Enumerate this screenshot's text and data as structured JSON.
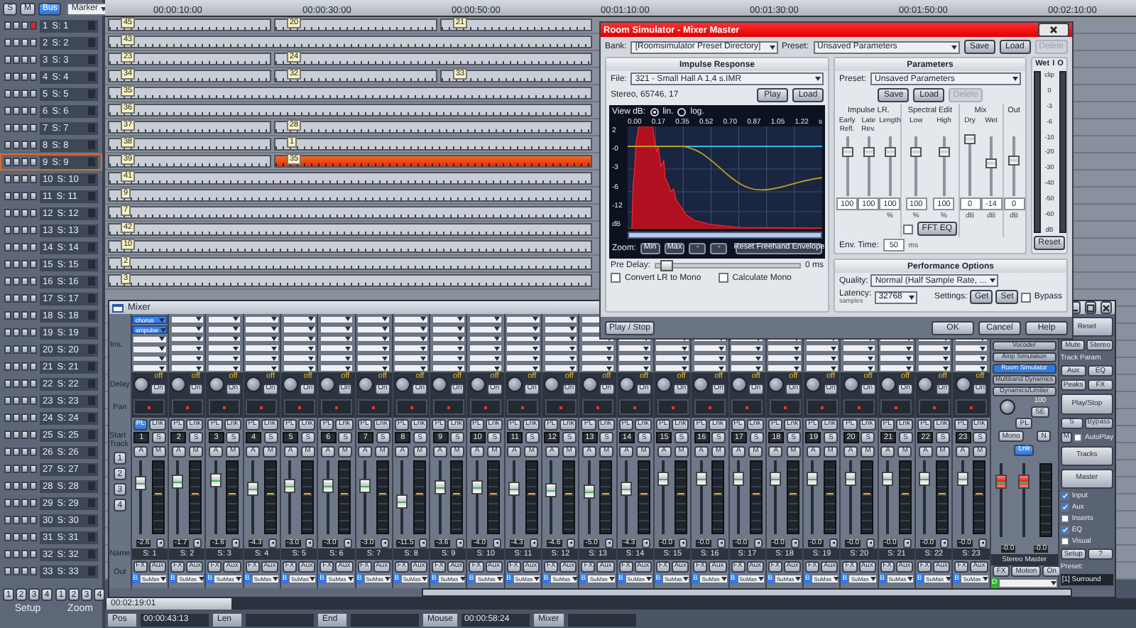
{
  "toolbar": {
    "buttons": [
      {
        "label": "S",
        "selected": false
      },
      {
        "label": "M",
        "selected": false
      },
      {
        "label": "Bus",
        "selected": true
      }
    ],
    "marker": "Marker"
  },
  "ruler": [
    "00:00:10:00",
    "00:00:30:00",
    "00:00:50:00",
    "00:01:10:00",
    "00:01:30:00",
    "00:01:50:00",
    "00:02:10:00"
  ],
  "tracks": [
    {
      "number": "1",
      "name": "S: 1",
      "armed": true,
      "selected": false,
      "clips": [
        {
          "label": "45",
          "selected": false
        },
        {
          "label": "20",
          "selected": false
        },
        {
          "label": "21",
          "selected": false
        }
      ]
    },
    {
      "number": "2",
      "name": "S: 2",
      "armed": false,
      "selected": false,
      "clips": [
        {
          "label": "43",
          "selected": false
        }
      ]
    },
    {
      "number": "3",
      "name": "S: 3",
      "armed": false,
      "selected": false,
      "clips": [
        {
          "label": "23",
          "selected": false
        },
        {
          "label": "24",
          "selected": false
        }
      ]
    },
    {
      "number": "4",
      "name": "S: 4",
      "armed": false,
      "selected": false,
      "clips": [
        {
          "label": "34",
          "selected": false
        },
        {
          "label": "32",
          "selected": false
        },
        {
          "label": "33",
          "selected": false
        }
      ]
    },
    {
      "number": "5",
      "name": "S: 5",
      "armed": false,
      "selected": false,
      "clips": [
        {
          "label": "35",
          "selected": false
        }
      ]
    },
    {
      "number": "6",
      "name": "S: 6",
      "armed": false,
      "selected": false,
      "clips": [
        {
          "label": "36",
          "selected": false
        }
      ]
    },
    {
      "number": "7",
      "name": "S: 7",
      "armed": false,
      "selected": false,
      "clips": [
        {
          "label": "37",
          "selected": false
        },
        {
          "label": "28",
          "selected": false
        }
      ]
    },
    {
      "number": "8",
      "name": "S: 8",
      "armed": false,
      "selected": false,
      "clips": [
        {
          "label": "38",
          "selected": false
        },
        {
          "label": "1",
          "selected": false
        }
      ]
    },
    {
      "number": "9",
      "name": "S: 9",
      "armed": false,
      "selected": true,
      "clips": [
        {
          "label": "39",
          "selected": false
        },
        {
          "label": "35",
          "selected": true
        }
      ]
    },
    {
      "number": "10",
      "name": "S: 10",
      "armed": false,
      "selected": false,
      "clips": [
        {
          "label": "41",
          "selected": false
        }
      ]
    },
    {
      "number": "11",
      "name": "S: 11",
      "armed": false,
      "selected": false,
      "clips": [
        {
          "label": "9",
          "selected": false
        }
      ]
    },
    {
      "number": "12",
      "name": "S: 12",
      "armed": false,
      "selected": false,
      "clips": [
        {
          "label": "7",
          "selected": false
        }
      ]
    },
    {
      "number": "13",
      "name": "S: 13",
      "armed": false,
      "selected": false,
      "clips": [
        {
          "label": "42",
          "selected": false
        }
      ]
    },
    {
      "number": "14",
      "name": "S: 14",
      "armed": false,
      "selected": false,
      "clips": [
        {
          "label": "10",
          "selected": false
        }
      ]
    },
    {
      "number": "15",
      "name": "S: 15",
      "armed": false,
      "selected": false,
      "clips": [
        {
          "label": "2",
          "selected": false
        }
      ]
    },
    {
      "number": "16",
      "name": "S: 16",
      "armed": false,
      "selected": false,
      "clips": [
        {
          "label": "3",
          "selected": false
        }
      ]
    },
    {
      "number": "17",
      "name": "S: 17",
      "armed": false,
      "selected": false
    },
    {
      "number": "18",
      "name": "S: 18",
      "armed": false,
      "selected": false
    },
    {
      "number": "19",
      "name": "S: 19",
      "armed": false,
      "selected": false
    },
    {
      "number": "20",
      "name": "S: 20",
      "armed": false,
      "selected": false
    },
    {
      "number": "21",
      "name": "S: 21",
      "armed": false,
      "selected": false
    },
    {
      "number": "22",
      "name": "S: 22",
      "armed": false,
      "selected": false
    },
    {
      "number": "23",
      "name": "S: 23",
      "armed": false,
      "selected": false
    },
    {
      "number": "24",
      "name": "S: 24",
      "armed": false,
      "selected": false
    },
    {
      "number": "25",
      "name": "S: 25",
      "armed": false,
      "selected": false
    },
    {
      "number": "26",
      "name": "S: 26",
      "armed": false,
      "selected": false
    },
    {
      "number": "27",
      "name": "S: 27",
      "armed": false,
      "selected": false
    },
    {
      "number": "28",
      "name": "S: 28",
      "armed": false,
      "selected": false
    },
    {
      "number": "29",
      "name": "S: 29",
      "armed": false,
      "selected": false
    },
    {
      "number": "30",
      "name": "S: 30",
      "armed": false,
      "selected": false
    },
    {
      "number": "31",
      "name": "S: 31",
      "armed": false,
      "selected": false
    },
    {
      "number": "32",
      "name": "S: 32",
      "armed": false,
      "selected": false
    },
    {
      "number": "33",
      "name": "S: 33",
      "armed": false,
      "selected": false
    }
  ],
  "footer": {
    "setup_buttons": [
      "1",
      "2",
      "3",
      "4"
    ],
    "setup_label": "Setup",
    "zoom_buttons": [
      "1",
      "2",
      "3",
      "4"
    ],
    "zoom_label": "Zoom"
  },
  "status_bar": {
    "scroll_time": "00:02:19:01",
    "fields": [
      {
        "label": "Pos",
        "value": "00:00:43:13"
      },
      {
        "label": "Len"
      },
      {
        "label": "End"
      },
      {
        "label": "Mouse",
        "value": "00:00:58:24"
      },
      {
        "label": "Mixer"
      }
    ]
  },
  "mixer": {
    "title": "Mixer",
    "row_labels": {
      "inserts": "Ins.",
      "delay": "Delay",
      "pan": "Pan",
      "start_track": "Start Track",
      "name": "Name",
      "out": "Out"
    },
    "start_buttons": [
      "1",
      "2",
      "3",
      "4"
    ],
    "channels": [
      {
        "number": "1",
        "name": "S: 1",
        "reading": "-2.6",
        "level": 0.7,
        "inserts": [
          "chorus",
          "ampulse"
        ],
        "delay": "off",
        "delay_button": "On",
        "pl": {
          "label": "PL",
          "selected": true
        },
        "link": "Lnk",
        "solo": "S",
        "auto": "A",
        "mute": "M",
        "fx": "FX",
        "aux": "Aux",
        "out_badge": "B",
        "out": "SuMas"
      },
      {
        "number": "2",
        "name": "S: 2",
        "reading": "-1.7",
        "level": 0.72,
        "delay": "off",
        "delay_button": "On",
        "pl": {
          "label": "PL",
          "selected": false
        },
        "link": "Lnk",
        "solo": "S",
        "auto": "A",
        "mute": "M",
        "fx": "FX",
        "aux": "Aux",
        "out_badge": "B",
        "out": "SuMas"
      },
      {
        "number": "3",
        "name": "S: 3",
        "reading": "-1.6",
        "level": 0.74,
        "delay": "off",
        "delay_button": "On",
        "pl": {
          "label": "PL",
          "selected": false
        },
        "link": "Lnk",
        "solo": "S",
        "auto": "A",
        "mute": "M",
        "fx": "FX",
        "aux": "Aux",
        "out_badge": "B",
        "out": "SuMas"
      },
      {
        "number": "4",
        "name": "S: 4",
        "reading": "-4.3",
        "level": 0.62,
        "delay": "off",
        "delay_button": "On",
        "pl": {
          "label": "PL",
          "selected": false
        },
        "link": "Lnk",
        "solo": "S",
        "auto": "A",
        "mute": "M",
        "fx": "FX",
        "aux": "Aux",
        "out_badge": "B",
        "out": "SuMas"
      },
      {
        "number": "5",
        "name": "S: 5",
        "reading": "-3.0",
        "level": 0.66,
        "delay": "off",
        "delay_button": "On",
        "pl": {
          "label": "PL",
          "selected": false
        },
        "link": "Lnk",
        "solo": "S",
        "auto": "A",
        "mute": "M",
        "fx": "FX",
        "aux": "Aux",
        "out_badge": "B",
        "out": "SuMas"
      },
      {
        "number": "6",
        "name": "S: 6",
        "reading": "-3.0",
        "level": 0.66,
        "delay": "off",
        "delay_button": "On",
        "pl": {
          "label": "PL",
          "selected": false
        },
        "link": "Lnk",
        "solo": "S",
        "auto": "A",
        "mute": "M",
        "fx": "FX",
        "aux": "Aux",
        "out_badge": "B",
        "out": "SuMas"
      },
      {
        "number": "7",
        "name": "S: 7",
        "reading": "-3.0",
        "level": 0.66,
        "delay": "off",
        "delay_button": "On",
        "pl": {
          "label": "PL",
          "selected": false
        },
        "link": "Lnk",
        "solo": "S",
        "auto": "A",
        "mute": "M",
        "fx": "FX",
        "aux": "Aux",
        "out_badge": "B",
        "out": "SuMas"
      },
      {
        "number": "8",
        "name": "S: 8",
        "reading": "-11.5",
        "level": 0.45,
        "delay": "off",
        "delay_button": "On",
        "pl": {
          "label": "PL",
          "selected": false
        },
        "link": "Lnk",
        "solo": "S",
        "auto": "A",
        "mute": "M",
        "fx": "FX",
        "aux": "Aux",
        "out_badge": "B",
        "out": "SuMas"
      },
      {
        "number": "9",
        "name": "S: 9",
        "reading": "-3.6",
        "level": 0.64,
        "delay": "off",
        "delay_button": "On",
        "pl": {
          "label": "PL",
          "selected": false
        },
        "link": "Lnk",
        "solo": "S",
        "auto": "A",
        "mute": "M",
        "fx": "FX",
        "aux": "Aux",
        "out_badge": "B",
        "out": "SuMas"
      },
      {
        "number": "10",
        "name": "S: 10",
        "reading": "-4.0",
        "level": 0.63,
        "delay": "off",
        "delay_button": "On",
        "pl": {
          "label": "PL",
          "selected": false
        },
        "link": "Lnk",
        "solo": "S",
        "auto": "A",
        "mute": "M",
        "fx": "FX",
        "aux": "Aux",
        "out_badge": "B",
        "out": "SuMas"
      },
      {
        "number": "11",
        "name": "S: 11",
        "reading": "-4.3",
        "level": 0.62,
        "delay": "off",
        "delay_button": "On",
        "pl": {
          "label": "PL",
          "selected": false
        },
        "link": "Lnk",
        "solo": "S",
        "auto": "A",
        "mute": "M",
        "fx": "FX",
        "aux": "Aux",
        "out_badge": "B",
        "out": "SuMas"
      },
      {
        "number": "12",
        "name": "S: 12",
        "reading": "-4.6",
        "level": 0.6,
        "delay": "off",
        "delay_button": "On",
        "pl": {
          "label": "PL",
          "selected": false
        },
        "link": "Lnk",
        "solo": "S",
        "auto": "A",
        "mute": "M",
        "fx": "FX",
        "aux": "Aux",
        "out_badge": "B",
        "out": "SuMas"
      },
      {
        "number": "13",
        "name": "S: 13",
        "reading": "-5.0",
        "level": 0.58,
        "delay": "off",
        "delay_button": "On",
        "pl": {
          "label": "PL",
          "selected": false
        },
        "link": "Lnk",
        "solo": "S",
        "auto": "A",
        "mute": "M",
        "fx": "FX",
        "aux": "Aux",
        "out_badge": "B",
        "out": "SuMas"
      },
      {
        "number": "14",
        "name": "S: 14",
        "reading": "-4.3",
        "level": 0.62,
        "delay": "off",
        "delay_button": "On",
        "pl": {
          "label": "PL",
          "selected": false
        },
        "link": "Lnk",
        "solo": "S",
        "auto": "A",
        "mute": "M",
        "fx": "FX",
        "aux": "Aux",
        "out_badge": "B",
        "out": "SuMas"
      },
      {
        "number": "15",
        "name": "S: 15",
        "reading": "-0.0",
        "level": 0.75,
        "delay": "off",
        "delay_button": "On",
        "pl": {
          "label": "PL",
          "selected": false
        },
        "link": "Lnk",
        "solo": "S",
        "auto": "A",
        "mute": "M",
        "fx": "FX",
        "aux": "Aux",
        "out_badge": "B",
        "out": "SuMas"
      },
      {
        "number": "16",
        "name": "S: 16",
        "reading": "-0.0",
        "level": 0.75,
        "delay": "off",
        "delay_button": "On",
        "pl": {
          "label": "PL",
          "selected": false
        },
        "link": "Lnk",
        "solo": "S",
        "auto": "A",
        "mute": "M",
        "fx": "FX",
        "aux": "Aux",
        "out_badge": "B",
        "out": "SuMas"
      },
      {
        "number": "17",
        "name": "S: 17",
        "reading": "-0.0",
        "level": 0.75,
        "delay": "off",
        "delay_button": "On",
        "pl": {
          "label": "PL",
          "selected": false
        },
        "link": "Lnk",
        "solo": "S",
        "auto": "A",
        "mute": "M",
        "fx": "FX",
        "aux": "Aux",
        "out_badge": "B",
        "out": "SuMas"
      },
      {
        "number": "18",
        "name": "S: 18",
        "reading": "-0.0",
        "level": 0.75,
        "delay": "off",
        "delay_button": "On",
        "pl": {
          "label": "PL",
          "selected": false
        },
        "link": "Lnk",
        "solo": "S",
        "auto": "A",
        "mute": "M",
        "fx": "FX",
        "aux": "Aux",
        "out_badge": "B",
        "out": "SuMas"
      },
      {
        "number": "19",
        "name": "S: 19",
        "reading": "-0.0",
        "level": 0.75,
        "delay": "off",
        "delay_button": "On",
        "pl": {
          "label": "PL",
          "selected": false
        },
        "link": "Lnk",
        "solo": "S",
        "auto": "A",
        "mute": "M",
        "fx": "FX",
        "aux": "Aux",
        "out_badge": "B",
        "out": "SuMas"
      },
      {
        "number": "20",
        "name": "S: 20",
        "reading": "-0.0",
        "level": 0.75,
        "delay": "off",
        "delay_button": "On",
        "pl": {
          "label": "PL",
          "selected": false
        },
        "link": "Lnk",
        "solo": "S",
        "auto": "A",
        "mute": "M",
        "fx": "FX",
        "aux": "Aux",
        "out_badge": "B",
        "out": "SuMas"
      },
      {
        "number": "21",
        "name": "S: 21",
        "reading": "-0.0",
        "level": 0.75,
        "delay": "off",
        "delay_button": "On",
        "pl": {
          "label": "PL",
          "selected": false
        },
        "link": "Lnk",
        "solo": "S",
        "auto": "A",
        "mute": "M",
        "fx": "FX",
        "aux": "Aux",
        "out_badge": "B",
        "out": "SuMas"
      },
      {
        "number": "22",
        "name": "S: 22",
        "reading": "-0.0",
        "level": 0.75,
        "delay": "off",
        "delay_button": "On",
        "pl": {
          "label": "PL",
          "selected": false
        },
        "link": "Lnk",
        "solo": "S",
        "auto": "A",
        "mute": "M",
        "fx": "FX",
        "aux": "Aux",
        "out_badge": "B",
        "out": "SuMas"
      },
      {
        "number": "23",
        "name": "S: 23",
        "reading": "-0.0",
        "level": 0.75,
        "delay": "off",
        "delay_button": "On",
        "pl": {
          "label": "PL",
          "selected": false
        },
        "link": "Lnk",
        "solo": "S",
        "auto": "A",
        "mute": "M",
        "fx": "FX",
        "aux": "Aux",
        "out_badge": "B",
        "out": "SuMas"
      }
    ],
    "master": {
      "fx": [
        {
          "label": "Vocoder",
          "selected": false
        },
        {
          "label": "Amp Simulation",
          "selected": false
        },
        {
          "label": "Room Simulator",
          "selected": true
        },
        {
          "label": "Multiband Dynamics",
          "selected": false
        },
        {
          "label": "Dynamics/Limiter",
          "selected": false
        }
      ],
      "knob_value": "100",
      "knob_button": "SE",
      "pl": "PL",
      "mono": "Mono",
      "n": "N",
      "link": {
        "label": "Lnk",
        "selected": true
      },
      "faders": [
        {
          "reading": "-0.0",
          "level": 0.75
        },
        {
          "reading": "-0.0",
          "level": 0.75
        }
      ],
      "name": "Stereo Master",
      "buttons": [
        "FX",
        "Motion",
        "On"
      ],
      "out_badge": "D"
    },
    "panel": {
      "reset": "Reset",
      "buttons": [
        "Mute",
        "Stereo"
      ],
      "track_param": "Track Param",
      "grid": [
        "Aux",
        "EQ",
        "Peaks",
        "FX"
      ],
      "play": "Play/Stop",
      "solo": "S",
      "bypass": "Bypass",
      "mute": "M",
      "autoplay": {
        "label": "AutoPlay",
        "checked": false
      },
      "views": [
        "Tracks",
        "Master"
      ],
      "checks": [
        {
          "label": "Input",
          "checked": true
        },
        {
          "label": "Aux",
          "checked": true
        },
        {
          "label": "Inserts",
          "checked": false
        },
        {
          "label": "EQ",
          "checked": true
        },
        {
          "label": "Visual",
          "checked": false
        }
      ],
      "setup": "Setup",
      "help": "?",
      "preset_label": "Preset:",
      "preset": "[1] Surround"
    }
  },
  "dialog": {
    "title": "Room Simulator - Mixer Master",
    "bank_label": "Bank:",
    "bank": "[Roomsimulator Preset Directory]",
    "preset_label": "Preset:",
    "preset": "Unsaved Parameters",
    "buttons": [
      {
        "label": "Save",
        "disabled": false
      },
      {
        "label": "Load",
        "disabled": false
      },
      {
        "label": "Delete",
        "disabled": true
      }
    ],
    "impulse": {
      "title": "Impulse Response",
      "file_label": "File:",
      "file": "321 - Small Hall A 1,4 s.IMR",
      "info": "Stereo, 65746, 17",
      "buttons": [
        "Play",
        "Load"
      ],
      "view_label": "View dB:",
      "view_options": [
        {
          "label": "lin.",
          "selected": true
        },
        {
          "label": "log.",
          "selected": false
        }
      ],
      "xticks": [
        "0.00",
        "0.17",
        "0.35",
        "0.52",
        "0.70",
        "0.87",
        "1.05",
        "1.22",
        "s"
      ],
      "yticks": [
        "2",
        "-0",
        "-3",
        "-6",
        "-12",
        "dB"
      ],
      "zoom_label": "Zoom:",
      "zoom_buttons": [
        "Min",
        "Max",
        "-",
        "-"
      ],
      "reset_envelope": "Reset Freehand Envelope",
      "pre_delay_label": "Pre Delay:",
      "pre_delay": {
        "level": 0.03,
        "reading": "0 ms"
      },
      "checks": [
        {
          "label": "Convert LR to Mono",
          "checked": false
        },
        {
          "label": "Calculate Mono",
          "checked": false
        }
      ]
    },
    "parameters": {
      "title": "Parameters",
      "preset_label": "Preset:",
      "preset": "Unsaved Parameters",
      "buttons": [
        {
          "label": "Save",
          "disabled": false
        },
        {
          "label": "Load",
          "disabled": false
        },
        {
          "label": "Delete",
          "disabled": true
        }
      ],
      "groups": [
        {
          "title": "Impulse LR.",
          "sliders": [
            {
              "label": "Early Refl.",
              "value": "100",
              "level": 0.75
            },
            {
              "label": "Late Rev.",
              "value": "100",
              "level": 0.75
            },
            {
              "label": "Length",
              "value": "100",
              "unit": "%",
              "level": 0.75
            }
          ]
        },
        {
          "title": "Spectral Edit",
          "sliders": [
            {
              "label": "Low",
              "value": "100",
              "unit": "%",
              "level": 0.75
            },
            {
              "label": "High",
              "value": "100",
              "unit": "%",
              "level": 0.75
            }
          ],
          "check": {
            "label": "FFT EQ",
            "checked": false
          }
        },
        {
          "title": "Mix",
          "sliders": [
            {
              "label": "Dry",
              "value": "0",
              "unit": "dB",
              "level": 0.95
            },
            {
              "label": "Wet",
              "value": "-14",
              "unit": "dB",
              "level": 0.55
            }
          ]
        },
        {
          "title": "Out",
          "sliders": [
            {
              "value": "0",
              "unit": "dB",
              "level": 0.6
            }
          ]
        }
      ],
      "env_label": "Env. Time:",
      "env_value": "50",
      "env_unit": "ms"
    },
    "meter": {
      "labels": [
        "Wet",
        "I",
        "O"
      ],
      "scale": [
        "clip",
        "0",
        "-3",
        "-6",
        "-10",
        "-20",
        "-30",
        "-40",
        "-50",
        "-60",
        "dB"
      ],
      "reset": "Reset"
    },
    "performance": {
      "title": "Performance Options",
      "quality_label": "Quality:",
      "quality": "Normal (Half Sample Rate, ...",
      "latency_label": "Latency:",
      "latency_unit": "samples",
      "latency": "32768",
      "settings_label": "Settings:",
      "settings_buttons": [
        "Get",
        "Set"
      ],
      "bypass": {
        "label": "Bypass",
        "checked": false
      }
    },
    "footer": {
      "play": "Play / Stop",
      "buttons": [
        "OK",
        "Cancel",
        "Help"
      ]
    }
  }
}
